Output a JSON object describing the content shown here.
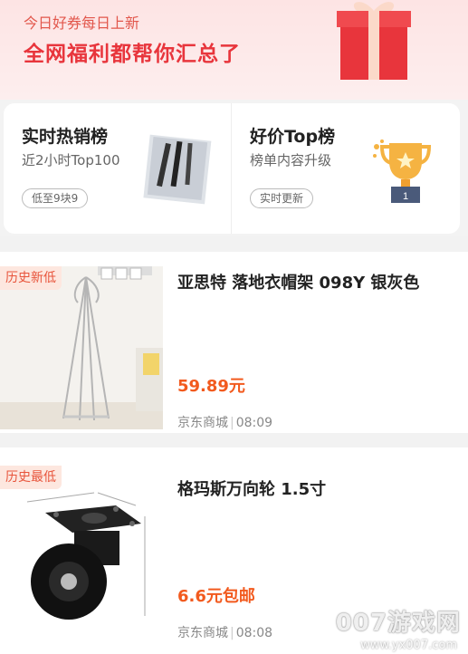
{
  "banner": {
    "subtitle": "今日好券每日上新",
    "title": "全网福利都帮你汇总了"
  },
  "hot_card": {
    "title": "实时热销榜",
    "desc": "近2小时Top100",
    "pill": "低至9块9"
  },
  "top_card": {
    "title": "好价Top榜",
    "desc": "榜单内容升级",
    "pill": "实时更新",
    "trophy_number": "1"
  },
  "products": [
    {
      "badge": "历史新低",
      "title": "亚思特  落地衣帽架  098Y 银灰色",
      "price": "59.89元",
      "store": "京东商城",
      "time": "08:09"
    },
    {
      "badge": "历史最低",
      "title": "格玛斯万向轮  1.5寸",
      "price": "6.6元包邮",
      "store": "京东商城",
      "time": "08:08"
    }
  ],
  "watermark": {
    "brand": "007游戏网",
    "url": "www.yx007.com"
  },
  "colors": {
    "accent": "#e8353c",
    "price": "#f25a1e",
    "badge_bg": "#fde7df"
  }
}
